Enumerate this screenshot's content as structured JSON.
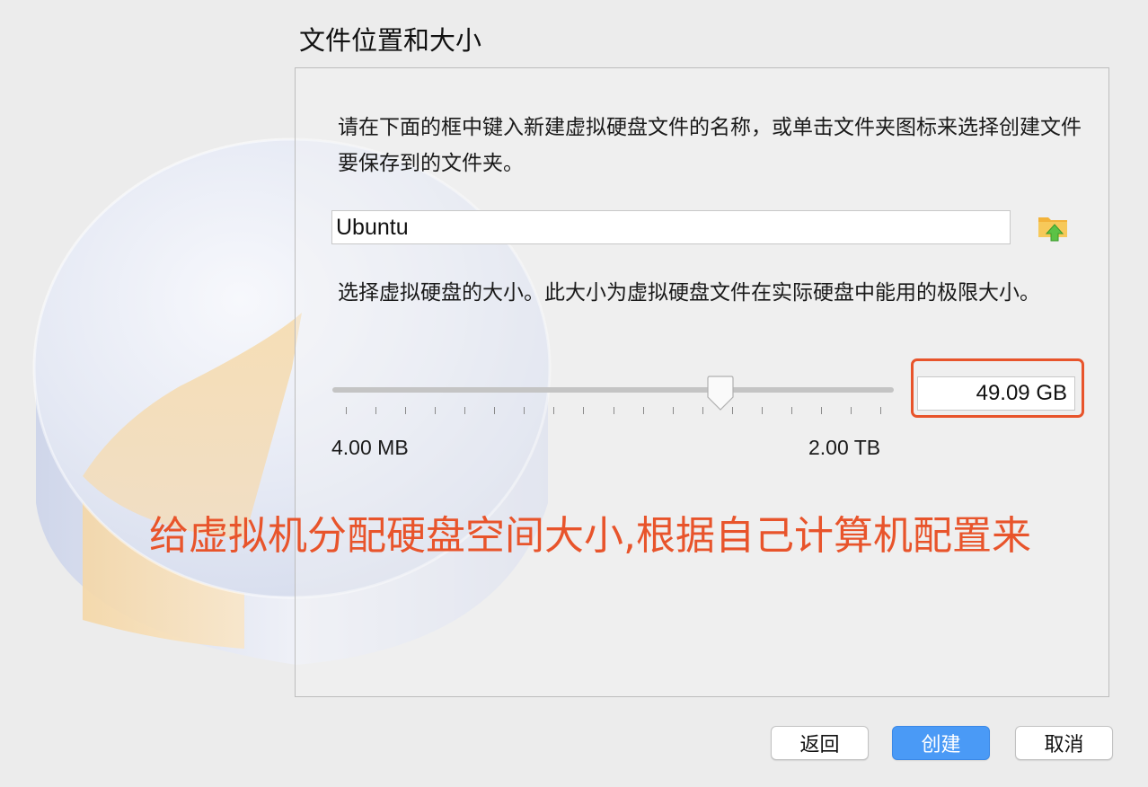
{
  "window": {
    "title": "文件位置和大小"
  },
  "location": {
    "description": "请在下面的框中键入新建虚拟硬盘文件的名称，或单击文件夹图标来选择创建文件要保存到的文件夹。",
    "file_name": "Ubuntu",
    "folder_icon": "folder-up-arrow-icon"
  },
  "size": {
    "description": "选择虚拟硬盘的大小。此大小为虚拟硬盘文件在实际硬盘中能用的极限大小。",
    "slider_min_label": "4.00 MB",
    "slider_max_label": "2.00 TB",
    "slider_position": 0.7,
    "slider_ticks": 19,
    "value": "49.09 GB"
  },
  "annotation": {
    "text": "给虚拟机分配硬盘空间大小,根据自己计算机配置来",
    "color": "#e8542b"
  },
  "buttons": {
    "back_label": "返回",
    "create_label": "创建",
    "cancel_label": "取消"
  },
  "colors": {
    "accent": "#4a9af6",
    "annotation": "#e8542b"
  }
}
